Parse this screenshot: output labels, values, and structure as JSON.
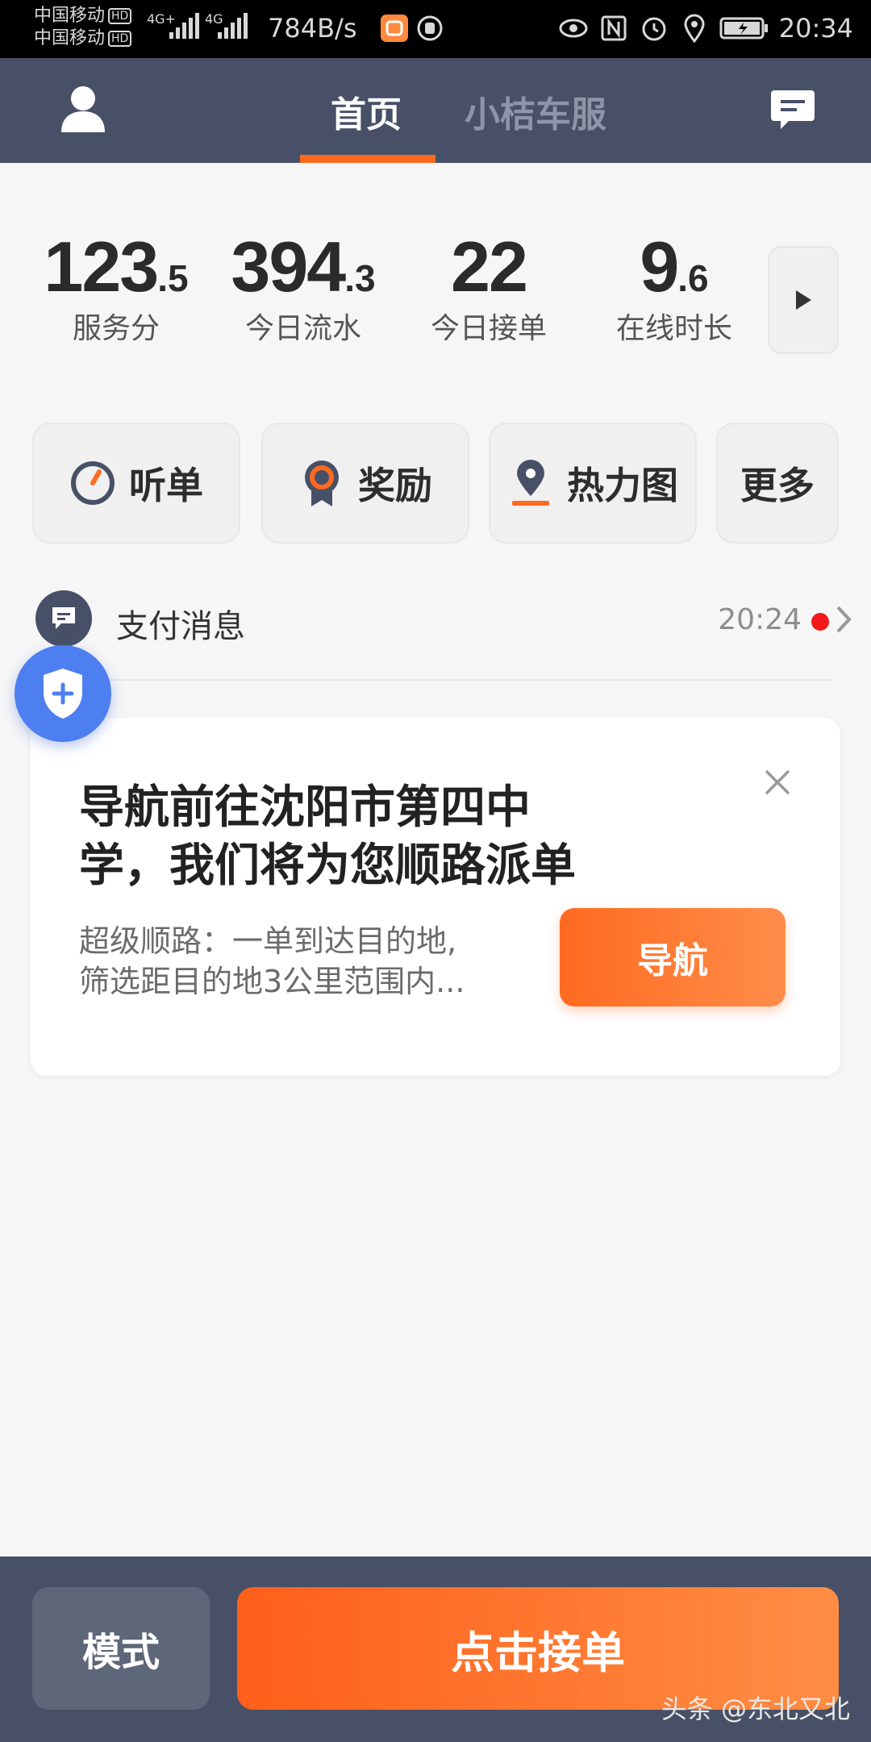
{
  "status_bar": {
    "carrier1": "中国移动",
    "carrier2": "中国移动",
    "hd_badge": "HD",
    "net1": "4G+",
    "net2": "4G",
    "speed": "784B/s",
    "time": "20:34",
    "icons": [
      "didi-app-icon",
      "hand-icon",
      "eye-icon",
      "nfc-icon",
      "alarm-icon",
      "location-icon",
      "battery-icon"
    ]
  },
  "header": {
    "tabs": [
      {
        "label": "首页",
        "active": true
      },
      {
        "label": "小桔车服",
        "active": false
      }
    ],
    "accent_color": "#ff6a1f",
    "bg_color": "#475066"
  },
  "stats": [
    {
      "int": "123",
      "dec": ".5",
      "label": "服务分"
    },
    {
      "int": "394",
      "dec": ".3",
      "label": "今日流水"
    },
    {
      "int": "22",
      "dec": "",
      "label": "今日接单"
    },
    {
      "int": "9",
      "dec": ".6",
      "label": "在线时长"
    }
  ],
  "quick_actions": [
    {
      "label": "听单",
      "icon": "clock-icon"
    },
    {
      "label": "奖励",
      "icon": "medal-icon"
    },
    {
      "label": "热力图",
      "icon": "map-pin-icon"
    },
    {
      "label": "更多",
      "icon": ""
    }
  ],
  "message": {
    "title": "支付消息",
    "time": "20:24"
  },
  "nav_card": {
    "title_line1": "导航前往沈阳市第四中",
    "title_line2": "学，我们将为您顺路派单",
    "desc_line1": "超级顺路：一单到达目的地,",
    "desc_line2": "筛选距目的地3公里范围内...",
    "button": "导航"
  },
  "bottom": {
    "mode_label": "模式",
    "accept_label": "点击接单"
  },
  "watermark": "头条 @东北又北"
}
